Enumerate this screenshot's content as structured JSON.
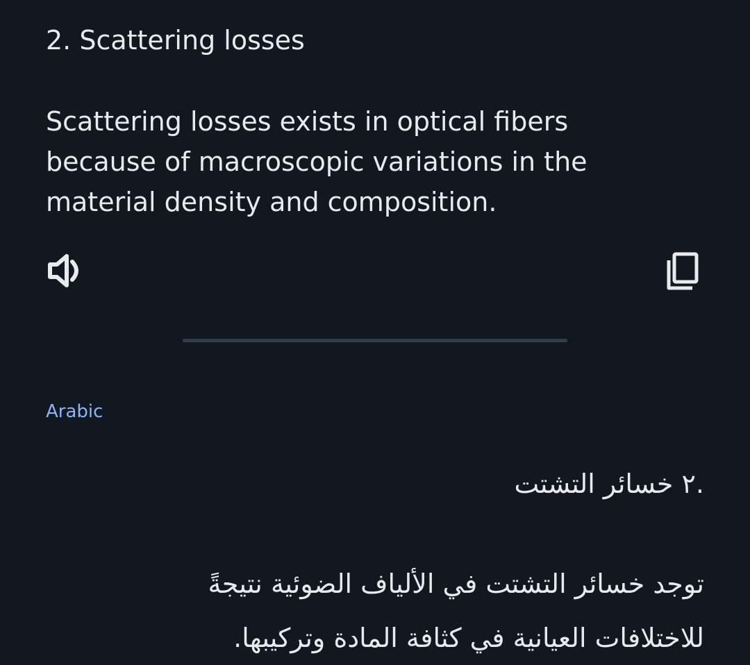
{
  "source": {
    "heading": "2. Scattering losses",
    "body_lines": [
      "Scattering losses exists in optical fibers",
      "because of macroscopic variations in the",
      "material density and composition."
    ]
  },
  "actions": {
    "speaker_icon": "volume-up-icon",
    "copy_icon": "copy-icon"
  },
  "target": {
    "language": "Arabic",
    "heading": ".٢ خسائر التشتت",
    "body_lines": [
      "توجد خسائر التشتت في الألياف الضوئية نتيجةً",
      "للاختلافات العيانية في كثافة المادة وتركيبها."
    ]
  },
  "colors": {
    "background": "#111820",
    "text": "#e8eaed",
    "accent": "#8ab4f8",
    "divider": "#2f3d4a"
  }
}
